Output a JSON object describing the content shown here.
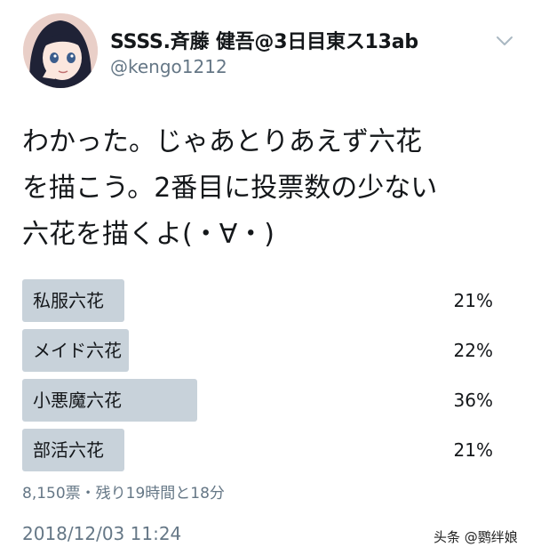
{
  "tweet": {
    "display_name": "SSSS.斉藤 健吾@3日目東ス13ab",
    "handle": "@kengo1212",
    "text": "わかった。じゃあとりあえず六花\nを描こう。2番目に投票数の少ない\n六花を描くよ(・∀・)",
    "timestamp": "2018/12/03 11:24"
  },
  "poll": {
    "options": [
      {
        "label": "私服六花",
        "percent_label": "21%",
        "percent": 21
      },
      {
        "label": "メイド六花",
        "percent_label": "22%",
        "percent": 22
      },
      {
        "label": "小悪魔六花",
        "percent_label": "36%",
        "percent": 36
      },
      {
        "label": "部活六花",
        "percent_label": "21%",
        "percent": 21
      }
    ],
    "meta": "8,150票・残り19時間と18分"
  },
  "icons": {
    "avatar": "anime-girl-avatar",
    "menu": "chevron-down-icon"
  },
  "colors": {
    "poll_bar": "#c8d2da",
    "secondary_text": "#657786"
  },
  "watermark": {
    "text": "头条 @鹦绊娘"
  }
}
